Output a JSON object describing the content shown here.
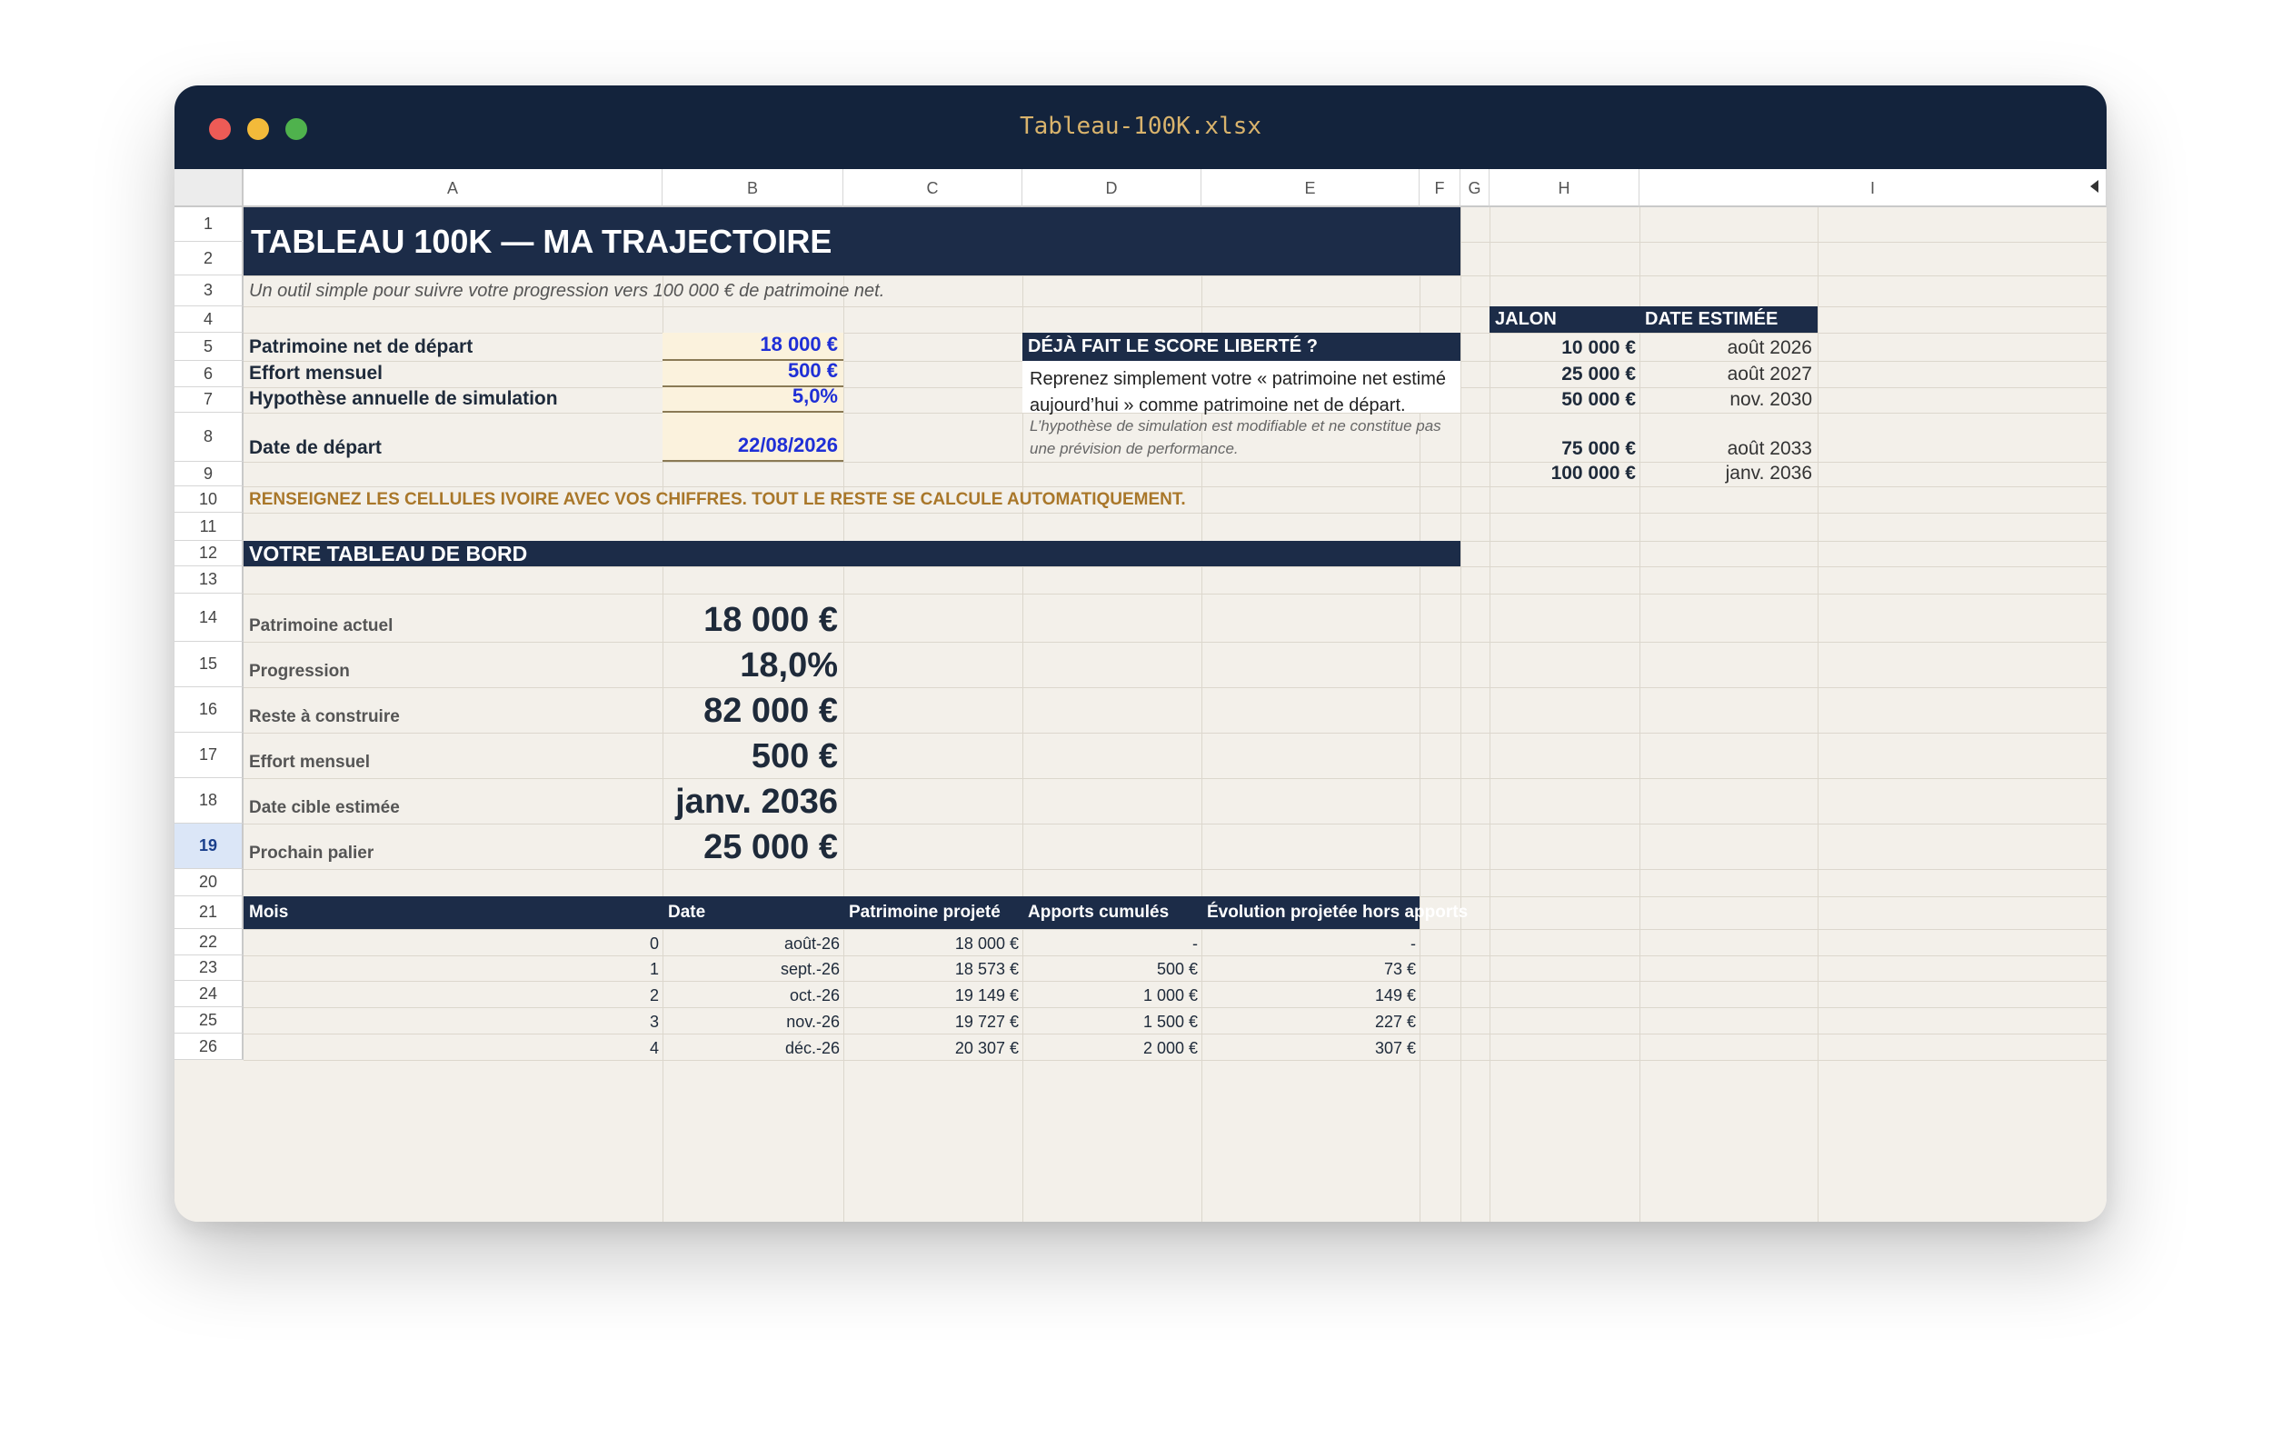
{
  "window": {
    "title": "Tableau-100K.xlsx"
  },
  "columns": [
    "A",
    "B",
    "C",
    "D",
    "E",
    "F",
    "G",
    "H",
    "I"
  ],
  "rows": [
    "1",
    "2",
    "3",
    "4",
    "5",
    "6",
    "7",
    "8",
    "9",
    "10",
    "11",
    "12",
    "13",
    "14",
    "15",
    "16",
    "17",
    "18",
    "19",
    "20",
    "21",
    "22",
    "23",
    "24",
    "25",
    "26"
  ],
  "selected_row": "19",
  "sheet": {
    "title": "TABLEAU 100K — MA TRAJECTOIRE",
    "subtitle": "Un outil simple pour suivre votre progression vers 100 000 € de patrimoine net.",
    "inputs": [
      {
        "label": "Patrimoine net de départ",
        "value": "18 000 €"
      },
      {
        "label": "Effort mensuel",
        "value": "500 €"
      },
      {
        "label": "Hypothèse annuelle de simulation",
        "value": "5,0%"
      },
      {
        "label": "Date de départ",
        "value": "22/08/2026"
      }
    ],
    "instruction": "RENSEIGNEZ LES CELLULES IVOIRE AVEC VOS CHIFFRES. TOUT LE RESTE SE CALCULE AUTOMATIQUEMENT.",
    "info_box": {
      "heading": "DÉJÀ FAIT LE SCORE LIBERTÉ ?",
      "body": "Reprenez simplement votre « patrimoine net estimé aujourd’hui » comme patrimoine net de départ.",
      "note": "L’hypothèse de simulation est modifiable et ne constitue pas une prévision de performance."
    },
    "dashboard": {
      "heading": "VOTRE TABLEAU DE BORD",
      "kpis": [
        {
          "label": "Patrimoine actuel",
          "value": "18 000 €"
        },
        {
          "label": "Progression",
          "value": "18,0%"
        },
        {
          "label": "Reste à construire",
          "value": "82 000 €"
        },
        {
          "label": "Effort mensuel",
          "value": "500 €"
        },
        {
          "label": "Date cible estimée",
          "value": "janv. 2036"
        },
        {
          "label": "Prochain palier",
          "value": "25 000 €"
        }
      ]
    },
    "projection": {
      "headers": [
        "Mois",
        "Date",
        "Patrimoine projeté",
        "Apports cumulés",
        "Évolution projetée hors apports"
      ],
      "rows": [
        [
          "0",
          "août-26",
          "18 000 €",
          "-",
          "-"
        ],
        [
          "1",
          "sept.-26",
          "18 573 €",
          "500 €",
          "73 €"
        ],
        [
          "2",
          "oct.-26",
          "19 149 €",
          "1 000 €",
          "149 €"
        ],
        [
          "3",
          "nov.-26",
          "19 727 €",
          "1 500 €",
          "227 €"
        ],
        [
          "4",
          "déc.-26",
          "20 307 €",
          "2 000 €",
          "307 €"
        ]
      ]
    },
    "milestones": {
      "headers": [
        "JALON",
        "DATE ESTIMÉE"
      ],
      "rows": [
        [
          "10 000 €",
          "août 2026"
        ],
        [
          "25 000 €",
          "août 2027"
        ],
        [
          "50 000 €",
          "nov. 2030"
        ],
        [
          "75 000 €",
          "août 2033"
        ],
        [
          "100 000 €",
          "janv. 2036"
        ]
      ]
    }
  }
}
